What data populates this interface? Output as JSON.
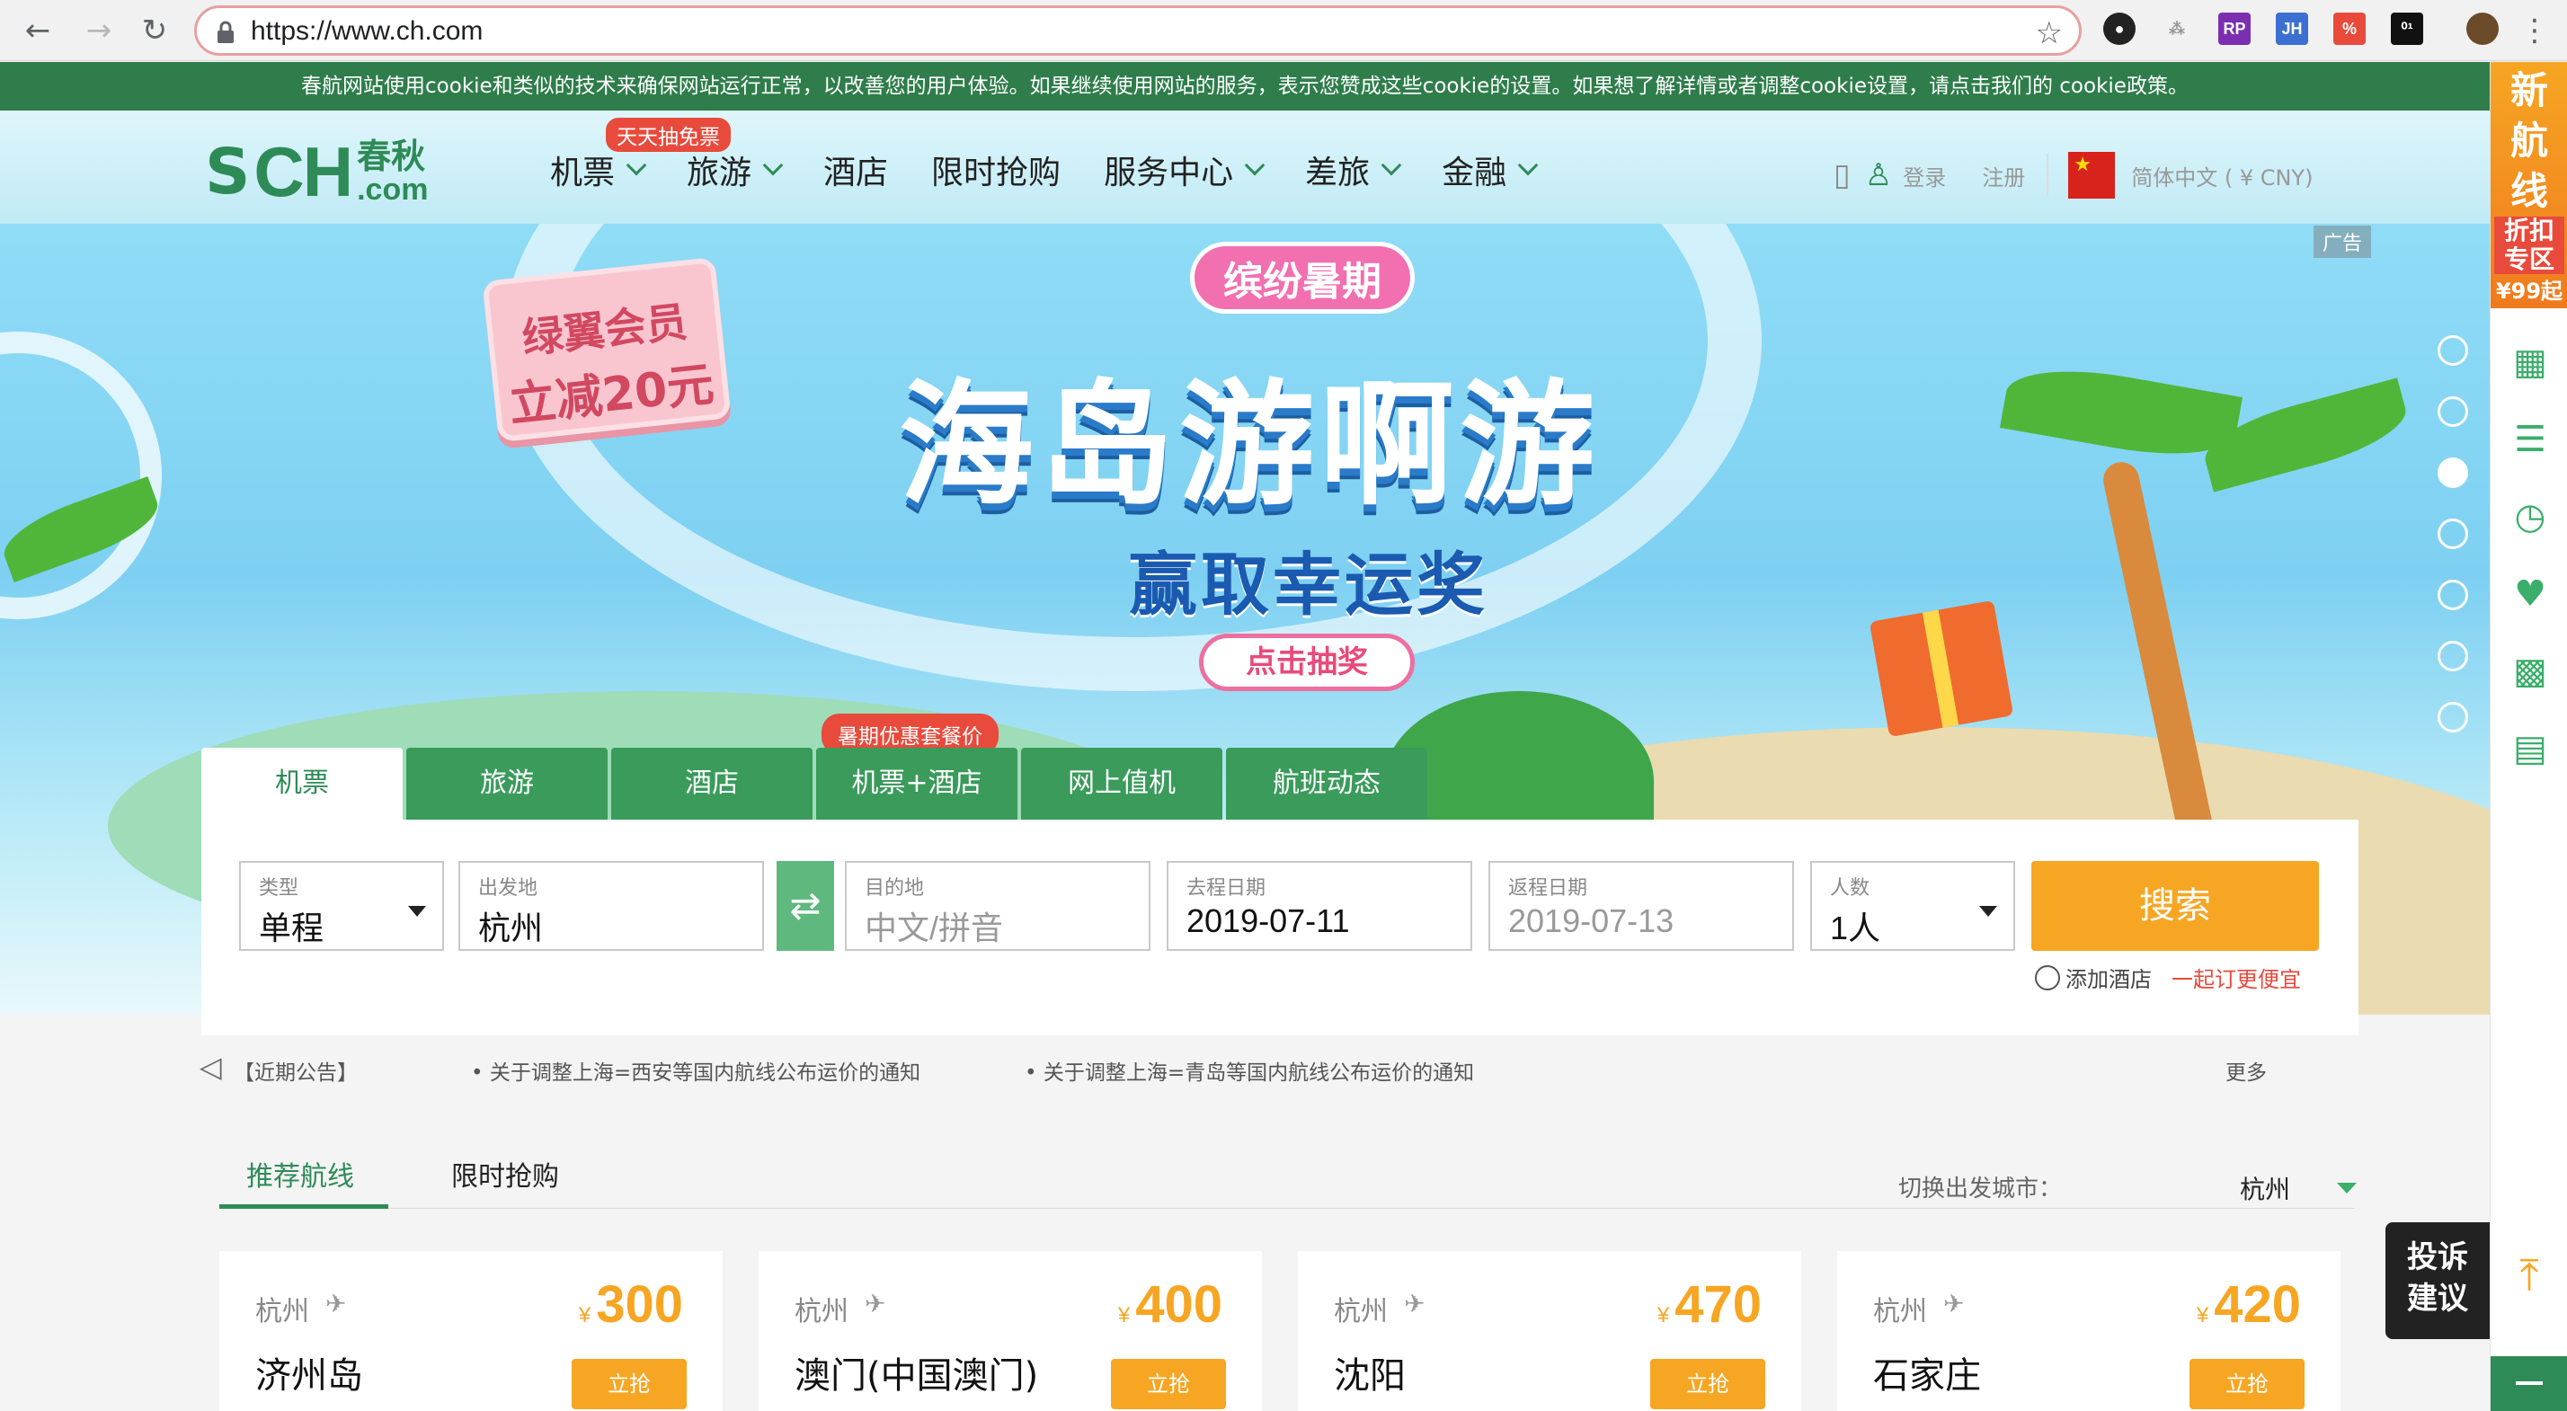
{
  "browser": {
    "url": "https://www.ch.com",
    "extensions": [
      "RP",
      "JH",
      "⁰¹"
    ]
  },
  "cookie_notice": "春航网站使用cookie和类似的技术来确保网站运行正常，以改善您的用户体验。如果继续使用网站的服务，表示您赞成这些cookie的设置。如果想了解详情或者调整cookie设置，请点击我们的 cookie政策。",
  "header": {
    "logo_main": "CH",
    "logo_cn": "春秋",
    "logo_dom": ".com",
    "hot_badge": "天天抽免票",
    "nav": [
      "机票",
      "旅游",
      "酒店",
      "限时抢购",
      "服务中心",
      "差旅",
      "金融"
    ],
    "login": "登录",
    "register": "注册",
    "language": "简体中文 ( ¥ CNY)"
  },
  "banner": {
    "ad_label": "广告",
    "pill": "缤纷暑期",
    "sign_line1": "绿翼会员",
    "sign_line2": "立减20元",
    "title": "海岛游啊游",
    "subtitle": "赢取幸运奖",
    "cta": "点击抽奖"
  },
  "search": {
    "tabs": [
      "机票",
      "旅游",
      "酒店",
      "机票+酒店",
      "网上值机",
      "航班动态"
    ],
    "promo_badge": "暑期优惠套餐价",
    "type_label": "类型",
    "type_value": "单程",
    "from_label": "出发地",
    "from_value": "杭州",
    "to_label": "目的地",
    "to_placeholder": "中文/拼音",
    "depart_label": "去程日期",
    "depart_value": "2019-07-11",
    "return_label": "返程日期",
    "return_value": "2019-07-13",
    "pax_label": "人数",
    "pax_value": "1人",
    "search_button": "搜索",
    "add_hotel": "添加酒店",
    "add_hotel_promo": "一起订更便宜"
  },
  "notices": {
    "label": "【近期公告】",
    "items": [
      "关于调整上海=西安等国内航线公布运价的通知",
      "关于调整上海=青岛等国内航线公布运价的通知"
    ],
    "more": "更多"
  },
  "section": {
    "tab_recommended": "推荐航线",
    "tab_flash": "限时抢购",
    "switch_city_label": "切换出发城市：",
    "city": "杭州"
  },
  "routes": [
    {
      "from": "杭州",
      "to": "济州岛",
      "currency": "¥",
      "price": "300",
      "buy": "立抢"
    },
    {
      "from": "杭州",
      "to": "澳门(中国澳门)",
      "currency": "¥",
      "price": "400",
      "buy": "立抢"
    },
    {
      "from": "杭州",
      "to": "沈阳",
      "currency": "¥",
      "price": "470",
      "buy": "立抢"
    },
    {
      "from": "杭州",
      "to": "石家庄",
      "currency": "¥",
      "price": "420",
      "buy": "立抢"
    }
  ],
  "sidebar": {
    "promo_line1": "新",
    "promo_line2": "航",
    "promo_line3": "线",
    "promo_line4": "折扣专区",
    "promo_line5": "¥99起",
    "complaint": "投诉建议"
  },
  "colors": {
    "brand_green": "#2e8b57",
    "accent_orange": "#f6a623",
    "alert_red": "#e84a3c"
  }
}
